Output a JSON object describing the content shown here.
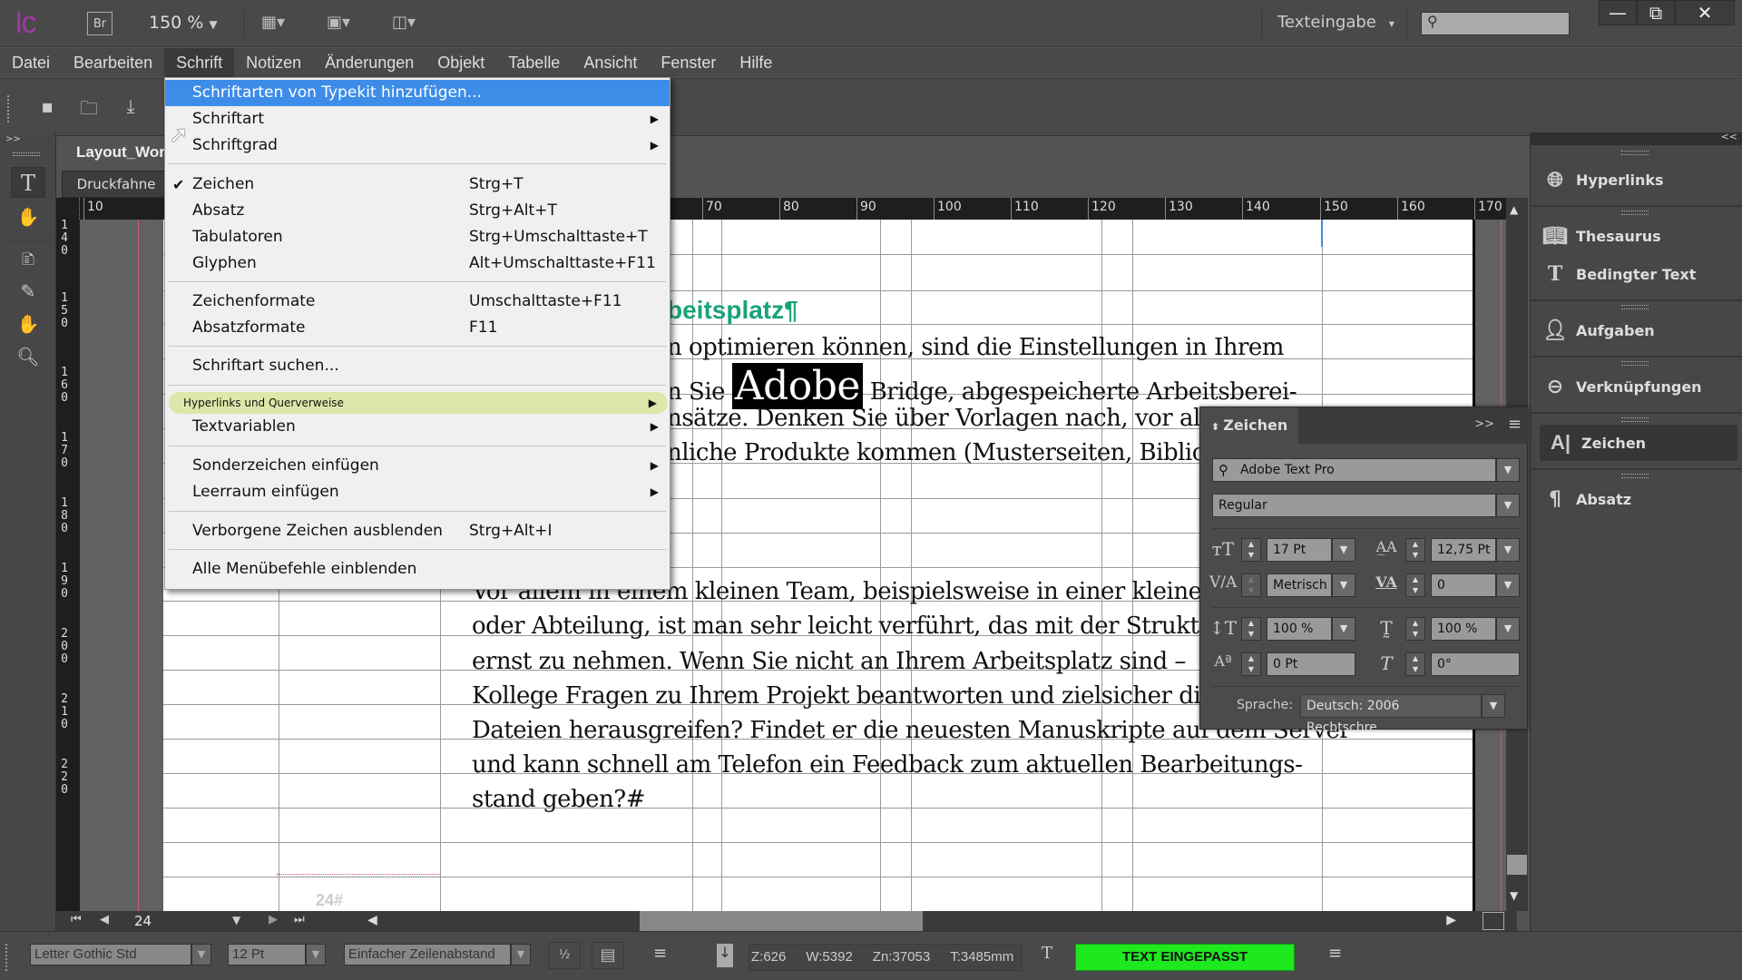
{
  "app": {
    "logo": "Ic",
    "bridge_label": "Br",
    "zoom": "150 %",
    "workspace": "Texteingabe",
    "search_placeholder": ""
  },
  "window_controls": {
    "minimize": "minimize",
    "restore": "restore",
    "close": "close"
  },
  "menubar": [
    "Datei",
    "Bearbeiten",
    "Schrift",
    "Notizen",
    "Änderungen",
    "Objekt",
    "Tabelle",
    "Ansicht",
    "Fenster",
    "Hilfe"
  ],
  "active_menu": "Schrift",
  "document": {
    "tab": "Layout_Wor",
    "view_mode": "Druckfahne",
    "ruler_h": [
      "10",
      "70",
      "80",
      "90",
      "100",
      "110",
      "120",
      "130",
      "140",
      "150",
      "160",
      "170"
    ],
    "ruler_v": [
      "140",
      "150",
      "160",
      "170",
      "180",
      "190",
      "200",
      "210",
      "220"
    ],
    "heading_fragment": "beitsplatz¶",
    "para1": [
      "n optimieren können, sind die Einstellungen in Ihrem",
      "n Sie",
      "Adobe",
      "Bridge, abgespeicherte Arbeitsberei-",
      "nsätze. Denken Sie über Vorlagen nach, vor alle",
      "nliche Produkte kommen (Musterseiten, Bibliot"
    ],
    "para2": [
      "Vor allem in einem kleinen Team, beispielsweise in einer kleinere",
      "oder Abteilung, ist man sehr leicht verführt, das mit der Struktur",
      "ernst zu nehmen. Wenn Sie nicht an Ihrem Arbeitsplatz sind –",
      "Kollege Fragen zu Ihrem Projekt beantworten und zielsicher di",
      "Dateien herausgreifen? Findet er die neuesten Manuskripte auf dem Server",
      "und kann schnell am Telefon ein Feedback zum aktuellen Bearbeitungs-",
      "stand geben?#"
    ],
    "page_marker": "24#"
  },
  "schrift_menu": {
    "items": [
      {
        "label": "Schriftarten von Typekit hinzufügen...",
        "shortcut": "",
        "submenu": false,
        "highlighted": true
      },
      {
        "label": "Schriftart",
        "shortcut": "",
        "submenu": true
      },
      {
        "label": "Schriftgrad",
        "shortcut": "",
        "submenu": true
      },
      {
        "label": "Zeichen",
        "shortcut": "Strg+T",
        "checked": true
      },
      {
        "label": "Absatz",
        "shortcut": "Strg+Alt+T"
      },
      {
        "label": "Tabulatoren",
        "shortcut": "Strg+Umschalttaste+T"
      },
      {
        "label": "Glyphen",
        "shortcut": "Alt+Umschalttaste+F11"
      },
      {
        "label": "Zeichenformate",
        "shortcut": "Umschalttaste+F11"
      },
      {
        "label": "Absatzformate",
        "shortcut": "F11"
      },
      {
        "label": "Schriftart suchen...",
        "shortcut": ""
      },
      {
        "label": "Hyperlinks und Querverweise",
        "shortcut": "",
        "submenu": true
      },
      {
        "label": "Textvariablen",
        "shortcut": "",
        "submenu": true
      },
      {
        "label": "Sonderzeichen einfügen",
        "shortcut": "",
        "submenu": true
      },
      {
        "label": "Leerraum einfügen",
        "shortcut": "",
        "submenu": true
      },
      {
        "label": "Verborgene Zeichen ausblenden",
        "shortcut": "Strg+Alt+I"
      },
      {
        "label": "Alle Menübefehle einblenden",
        "shortcut": ""
      }
    ]
  },
  "right_dock": {
    "items": [
      {
        "label": "Hyperlinks",
        "icon": "hyperlinks-icon"
      },
      {
        "label": "Thesaurus",
        "icon": "thesaurus-icon"
      },
      {
        "label": "Bedingter Text",
        "icon": "conditional-text-icon"
      },
      {
        "label": "Aufgaben",
        "icon": "assignments-icon"
      },
      {
        "label": "Verknüpfungen",
        "icon": "links-icon"
      },
      {
        "label": "Zeichen",
        "icon": "character-icon",
        "selected": true
      },
      {
        "label": "Absatz",
        "icon": "paragraph-icon"
      }
    ]
  },
  "zeichen_panel": {
    "title": "Zeichen",
    "font_family": "Adobe Text Pro",
    "font_style": "Regular",
    "font_size": "17 Pt",
    "leading": "12,75 Pt",
    "kerning": "Metrisch",
    "tracking": "0",
    "vertical_scale": "100 %",
    "horizontal_scale": "100 %",
    "baseline_shift": "0 Pt",
    "skew": "0°",
    "language_label": "Sprache:",
    "language": "Deutsch: 2006 Rechtschre..."
  },
  "page_nav": {
    "page": "24"
  },
  "statusbar": {
    "font": "Letter Gothic Std",
    "size": "12 Pt",
    "spacing": "Einfacher Zeilenabstand",
    "lines": "Z:626",
    "words": "W:5392",
    "chars": "Zn:37053",
    "depth": "T:3485mm",
    "fit_status": "TEXT EINGEPASST",
    "fit_color": "#1ee81e"
  }
}
